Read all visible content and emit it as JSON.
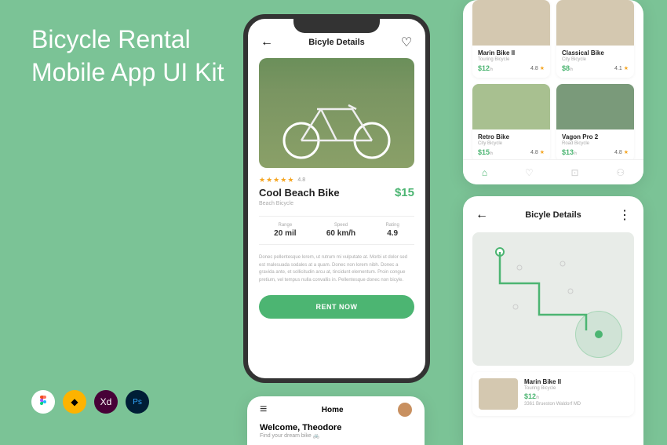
{
  "title_line1": "Bicycle Rental",
  "title_line2": "Mobile App UI Kit",
  "detail": {
    "header": "Bicyle Details",
    "rating_text": "4.8",
    "name": "Cool Beach Bike",
    "category": "Beach Bicycle",
    "price": "$15",
    "specs": {
      "range_label": "Range",
      "range_val": "20 mil",
      "speed_label": "Speed",
      "speed_val": "60 km/h",
      "rating_label": "Rating",
      "rating_val": "4.9"
    },
    "desc": "Donec pellentesque lorem, ut rutrum mi vulputate at. Morbi ut dolor sed est malesuada sodales at a quam. Donec non lorem nibh. Donec a gravida ante, et sollicitudin arcu at, tincidunt elementum. Proin congue pretium, vel tempus nulla convallis in. Pellentesque donec non bicyle.",
    "cta": "RENT NOW"
  },
  "catalog": {
    "items": [
      {
        "name": "Marin Bike II",
        "cat": "Touring Bicycle",
        "price": "$12",
        "unit": "/h",
        "rating": "4.8"
      },
      {
        "name": "Classical Bike",
        "cat": "City Bicycle",
        "price": "$8",
        "unit": "/h",
        "rating": "4.1"
      },
      {
        "name": "Retro Bike",
        "cat": "City Bicycle",
        "price": "$15",
        "unit": "/h",
        "rating": "4.8"
      },
      {
        "name": "Vagon Pro 2",
        "cat": "Road Bicycle",
        "price": "$13",
        "unit": "/h",
        "rating": "4.8"
      }
    ]
  },
  "home": {
    "title": "Home",
    "welcome": "Welcome, Theodore",
    "sub": "Find your dream bike 🚲"
  },
  "map": {
    "header": "Bicyle Details",
    "card": {
      "name": "Marin Bike II",
      "cat": "Touring Bicycle",
      "price": "$12",
      "unit": "/h",
      "addr": "3361 Brueston Waldorf MD"
    }
  }
}
